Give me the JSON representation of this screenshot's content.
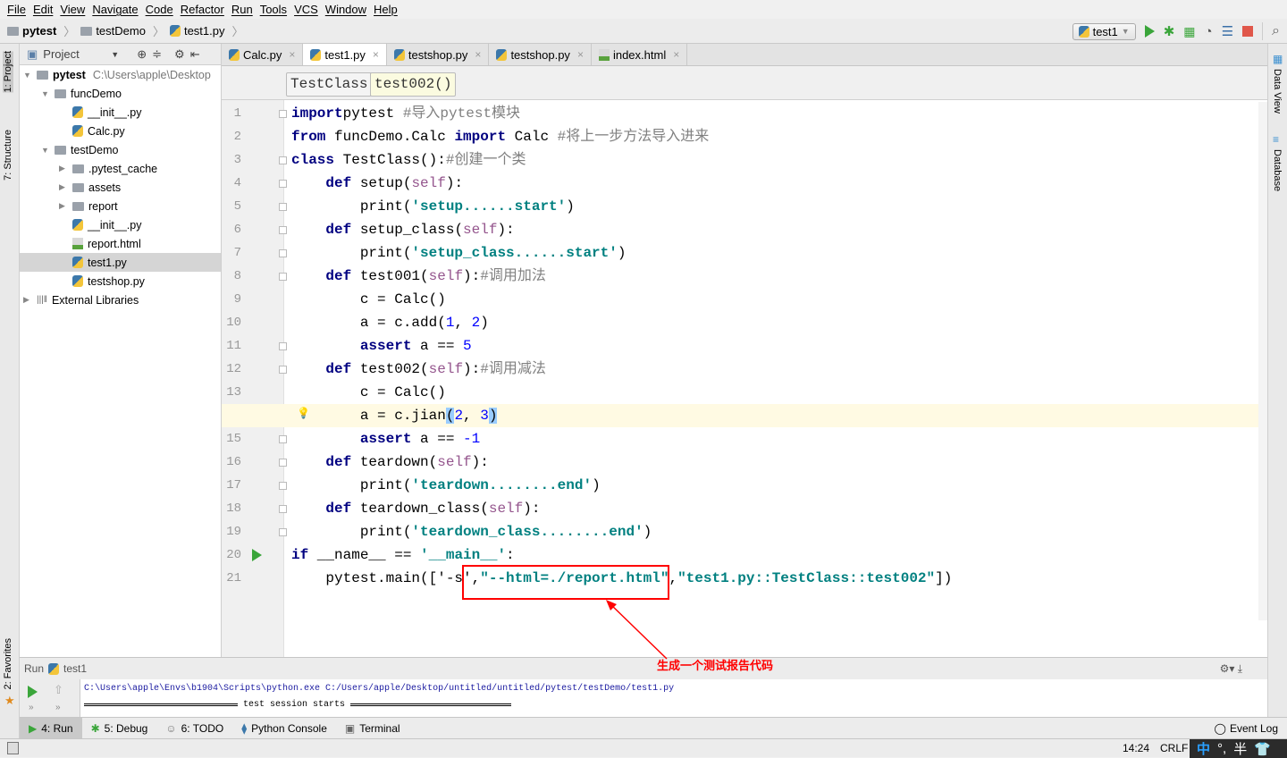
{
  "menu": [
    "File",
    "Edit",
    "View",
    "Navigate",
    "Code",
    "Refactor",
    "Run",
    "Tools",
    "VCS",
    "Window",
    "Help"
  ],
  "breadcrumb": [
    "pytest",
    "testDemo",
    "test1.py"
  ],
  "toolbar": {
    "run_config": "test1",
    "icons": [
      "run-icon",
      "debug-icon",
      "coverage-icon",
      "profile-icon",
      "concurrency-icon",
      "stop-icon",
      "search-icon"
    ],
    "stop_color": "#e0574a",
    "run_color": "#3aa53a"
  },
  "left_strip": {
    "project": "1: Project",
    "structure": "7: Structure",
    "favorites": "2: Favorites"
  },
  "right_strip": {
    "data_view": "Data View",
    "database": "Database"
  },
  "project": {
    "header": "Project",
    "tree": [
      {
        "label": "pytest",
        "path": "C:\\Users\\apple\\Desktop",
        "depth": 0,
        "type": "folder",
        "expanded": true,
        "bold": true
      },
      {
        "label": "funcDemo",
        "depth": 1,
        "type": "folder",
        "expanded": true
      },
      {
        "label": "__init__.py",
        "depth": 2,
        "type": "py"
      },
      {
        "label": "Calc.py",
        "depth": 2,
        "type": "py"
      },
      {
        "label": "testDemo",
        "depth": 1,
        "type": "folder",
        "expanded": true
      },
      {
        "label": ".pytest_cache",
        "depth": 2,
        "type": "folder",
        "expanded": false
      },
      {
        "label": "assets",
        "depth": 2,
        "type": "folder",
        "expanded": false
      },
      {
        "label": "report",
        "depth": 2,
        "type": "folder",
        "expanded": false
      },
      {
        "label": "__init__.py",
        "depth": 2,
        "type": "py"
      },
      {
        "label": "report.html",
        "depth": 2,
        "type": "html"
      },
      {
        "label": "test1.py",
        "depth": 2,
        "type": "py",
        "selected": true
      },
      {
        "label": "testshop.py",
        "depth": 2,
        "type": "py"
      },
      {
        "label": "External Libraries",
        "depth": 0,
        "type": "lib",
        "expanded": false
      }
    ]
  },
  "tabs": [
    {
      "label": "Calc.py",
      "type": "py"
    },
    {
      "label": "test1.py",
      "type": "py",
      "active": true
    },
    {
      "label": "testshop.py",
      "type": "py"
    },
    {
      "label": "testshop.py",
      "type": "py"
    },
    {
      "label": "index.html",
      "type": "html"
    }
  ],
  "editor_breadcrumbs": [
    "TestClass",
    "test002()"
  ],
  "code": [
    [
      [
        "kw",
        "import"
      ],
      [
        "",
        "pytest "
      ],
      [
        "cmt",
        "#导入pytest模块"
      ]
    ],
    [
      [
        "kw",
        "from"
      ],
      [
        "",
        " funcDemo.Calc "
      ],
      [
        "kw",
        "import"
      ],
      [
        "",
        " Calc "
      ],
      [
        "cmt",
        "#将上一步方法导入进来"
      ]
    ],
    [
      [
        "kw",
        "class"
      ],
      [
        "",
        " TestClass():"
      ],
      [
        "cmt",
        "#创建一个类"
      ]
    ],
    [
      [
        "",
        "    "
      ],
      [
        "kw",
        "def"
      ],
      [
        "",
        " setup("
      ],
      [
        "self",
        "self"
      ],
      [
        "",
        "):"
      ]
    ],
    [
      [
        "",
        "        print("
      ],
      [
        "str",
        "'setup......start'"
      ],
      [
        "",
        ")"
      ]
    ],
    [
      [
        "",
        "    "
      ],
      [
        "kw",
        "def"
      ],
      [
        "",
        " setup_class("
      ],
      [
        "self",
        "self"
      ],
      [
        "",
        "):"
      ]
    ],
    [
      [
        "",
        "        print("
      ],
      [
        "str",
        "'setup_class......start'"
      ],
      [
        "",
        ")"
      ]
    ],
    [
      [
        "",
        "    "
      ],
      [
        "kw",
        "def"
      ],
      [
        "",
        " test001("
      ],
      [
        "self",
        "self"
      ],
      [
        "",
        "):"
      ],
      [
        "cmt",
        "#调用加法"
      ]
    ],
    [
      [
        "",
        "        c = Calc()"
      ]
    ],
    [
      [
        "",
        "        a = c.add("
      ],
      [
        "num",
        "1"
      ],
      [
        "",
        ", "
      ],
      [
        "num",
        "2"
      ],
      [
        "",
        ")"
      ]
    ],
    [
      [
        "",
        "        "
      ],
      [
        "kw",
        "assert"
      ],
      [
        "",
        " a == "
      ],
      [
        "num",
        "5"
      ]
    ],
    [
      [
        "",
        "    "
      ],
      [
        "kw",
        "def"
      ],
      [
        "",
        " test002("
      ],
      [
        "self",
        "self"
      ],
      [
        "",
        "):"
      ],
      [
        "cmt",
        "#调用减法"
      ]
    ],
    [
      [
        "",
        "        c = Calc()"
      ]
    ],
    [
      [
        "",
        "        a = c.jian"
      ],
      [
        "br",
        "("
      ],
      [
        "num",
        "2"
      ],
      [
        "",
        ", "
      ],
      [
        "num",
        "3"
      ],
      [
        "br",
        ")"
      ]
    ],
    [
      [
        "",
        "        "
      ],
      [
        "kw",
        "assert"
      ],
      [
        "",
        " a == "
      ],
      [
        "num",
        "-1"
      ]
    ],
    [
      [
        "",
        "    "
      ],
      [
        "kw",
        "def"
      ],
      [
        "",
        " teardown("
      ],
      [
        "self",
        "self"
      ],
      [
        "",
        "):"
      ]
    ],
    [
      [
        "",
        "        print("
      ],
      [
        "str",
        "'teardown........end'"
      ],
      [
        "",
        ")"
      ]
    ],
    [
      [
        "",
        "    "
      ],
      [
        "kw",
        "def"
      ],
      [
        "",
        " teardown_class("
      ],
      [
        "self",
        "self"
      ],
      [
        "",
        "):"
      ]
    ],
    [
      [
        "",
        "        print("
      ],
      [
        "str",
        "'teardown_class........end'"
      ],
      [
        "",
        ")"
      ]
    ],
    [
      [
        "kw",
        "if"
      ],
      [
        "",
        " __name__ == "
      ],
      [
        "str",
        "'__main__'"
      ],
      [
        "",
        ":"
      ]
    ],
    [
      [
        "",
        "    pytest.main(['-s',"
      ],
      [
        "str",
        "\"--html=./report.html\""
      ],
      [
        "",
        ","
      ],
      [
        "str",
        "\"test1.py::TestClass::test002\""
      ],
      [
        "",
        "])"
      ]
    ]
  ],
  "current_line": 14,
  "annotation": {
    "text": "生成一个测试报告代码",
    "color": "#ff0000"
  },
  "run": {
    "title": "Run",
    "config": "test1",
    "output": [
      "C:\\Users\\apple\\Envs\\b1904\\Scripts\\python.exe C:/Users/apple/Desktop/untitled/untitled/pytest/testDemo/test1.py",
      "test session starts"
    ]
  },
  "tool_tabs": [
    {
      "label": "4: Run",
      "active": true
    },
    {
      "label": "5: Debug"
    },
    {
      "label": "6: TODO"
    },
    {
      "label": "Python Console"
    },
    {
      "label": "Terminal"
    }
  ],
  "event_log": "Event Log",
  "status": {
    "position": "14:24",
    "line_sep": "CRLF"
  },
  "ime": {
    "mode": "中",
    "punct": "°,",
    "width": "半"
  }
}
